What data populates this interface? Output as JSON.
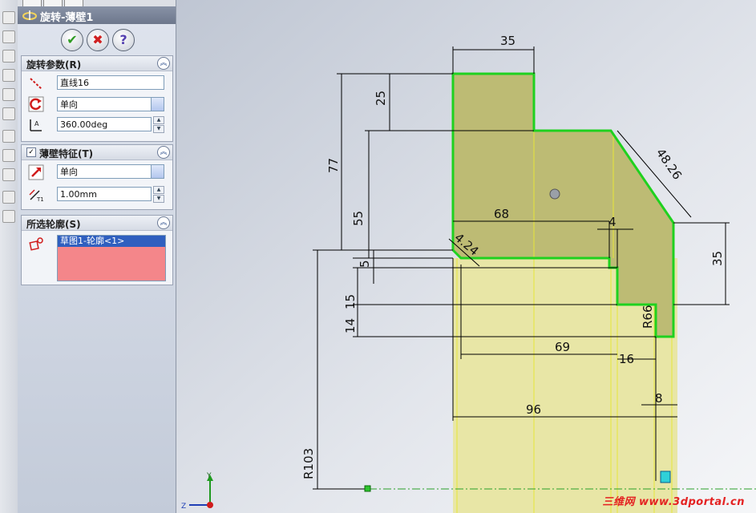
{
  "feature_panel": {
    "title": "旋转-薄壁1",
    "revolve_params": {
      "header": "旋转参数(R)",
      "axis_value": "直线16",
      "direction_value": "单向",
      "angle_value": "360.00deg"
    },
    "thin_feature": {
      "header": "薄壁特征(T)",
      "checked": true,
      "direction_value": "单向",
      "thickness_value": "1.00mm"
    },
    "selected_contours": {
      "header": "所选轮廓(S)",
      "items": [
        "草图1-轮廓<1>"
      ]
    }
  },
  "dimensions": {
    "d35_top": "35",
    "d25": "25",
    "d77": "77",
    "d55": "55",
    "d48": "48.26",
    "d68": "68",
    "d4": "4",
    "d4_24": "4.24",
    "d35_right": "35",
    "d5": "5",
    "d15": "15",
    "d14": "14",
    "dR66": "R66",
    "d69": "69",
    "d16": "16",
    "d8": "8",
    "d96": "96",
    "dR103": "R103"
  },
  "triad": {
    "y_label": "Y",
    "z_label": "Z"
  },
  "watermark": "三维网 www.3dportal.cn",
  "colors": {
    "profile": "#1fd11f",
    "solid": "#bdbb74",
    "dim_line": "#000000"
  }
}
